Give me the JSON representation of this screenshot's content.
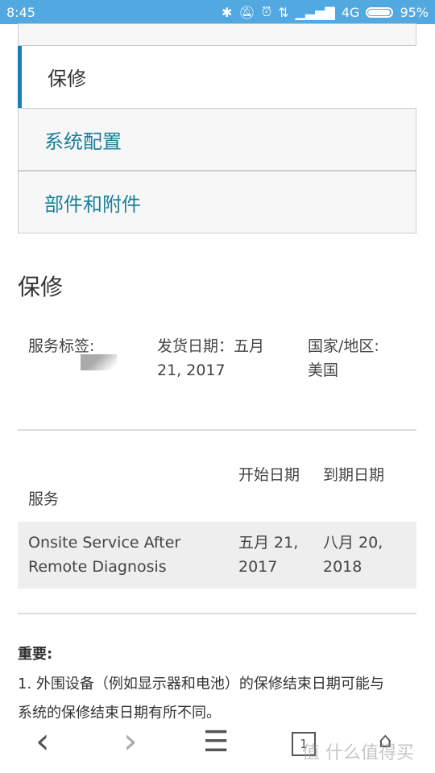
{
  "status_bar": {
    "time": "8:45",
    "network": "4G",
    "battery": "95%",
    "battery_level": 0.95,
    "icons": [
      "bluetooth-icon",
      "mute-icon",
      "alarm-icon",
      "data-arrows-icon",
      "signal-icon"
    ]
  },
  "tabs": [
    {
      "label": "保修",
      "active": true
    },
    {
      "label": "系统配置"
    },
    {
      "label": "部件和附件"
    }
  ],
  "section_title": "保修",
  "info": {
    "service_tag_label": "服务标签:",
    "ship_date_label": "发货日期：五月",
    "ship_date_value": "21, 2017",
    "country_label": "国家/地区:",
    "country_value": "美国"
  },
  "table": {
    "headers": [
      "服务",
      "开始日期",
      "到期日期"
    ],
    "rows": [
      [
        "Onsite Service After Remote Diagnosis",
        "五月 21, 2017",
        "八月 20, 2018"
      ]
    ]
  },
  "important": {
    "title": "重要:",
    "line1": "1. 外围设备（例如显示器和电池）的保修结束日期可能与",
    "line2": "系统的保修结束日期有所不同。"
  },
  "bottom_nav": {
    "back": "‹",
    "forward": "›",
    "menu": "☰",
    "tabs_count": "1",
    "watermark": "值 什么值得买"
  },
  "colors": {
    "status_bar": "#52a8e0",
    "accent": "#1a7fb5",
    "link": "#1a7f9a"
  }
}
